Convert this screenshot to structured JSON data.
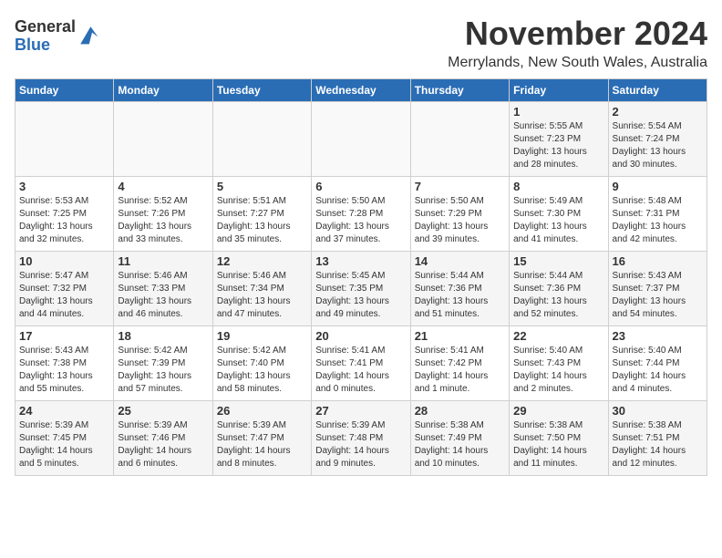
{
  "logo": {
    "general": "General",
    "blue": "Blue"
  },
  "header": {
    "month_title": "November 2024",
    "location": "Merrylands, New South Wales, Australia"
  },
  "weekdays": [
    "Sunday",
    "Monday",
    "Tuesday",
    "Wednesday",
    "Thursday",
    "Friday",
    "Saturday"
  ],
  "weeks": [
    [
      {
        "day": "",
        "info": ""
      },
      {
        "day": "",
        "info": ""
      },
      {
        "day": "",
        "info": ""
      },
      {
        "day": "",
        "info": ""
      },
      {
        "day": "",
        "info": ""
      },
      {
        "day": "1",
        "info": "Sunrise: 5:55 AM\nSunset: 7:23 PM\nDaylight: 13 hours\nand 28 minutes."
      },
      {
        "day": "2",
        "info": "Sunrise: 5:54 AM\nSunset: 7:24 PM\nDaylight: 13 hours\nand 30 minutes."
      }
    ],
    [
      {
        "day": "3",
        "info": "Sunrise: 5:53 AM\nSunset: 7:25 PM\nDaylight: 13 hours\nand 32 minutes."
      },
      {
        "day": "4",
        "info": "Sunrise: 5:52 AM\nSunset: 7:26 PM\nDaylight: 13 hours\nand 33 minutes."
      },
      {
        "day": "5",
        "info": "Sunrise: 5:51 AM\nSunset: 7:27 PM\nDaylight: 13 hours\nand 35 minutes."
      },
      {
        "day": "6",
        "info": "Sunrise: 5:50 AM\nSunset: 7:28 PM\nDaylight: 13 hours\nand 37 minutes."
      },
      {
        "day": "7",
        "info": "Sunrise: 5:50 AM\nSunset: 7:29 PM\nDaylight: 13 hours\nand 39 minutes."
      },
      {
        "day": "8",
        "info": "Sunrise: 5:49 AM\nSunset: 7:30 PM\nDaylight: 13 hours\nand 41 minutes."
      },
      {
        "day": "9",
        "info": "Sunrise: 5:48 AM\nSunset: 7:31 PM\nDaylight: 13 hours\nand 42 minutes."
      }
    ],
    [
      {
        "day": "10",
        "info": "Sunrise: 5:47 AM\nSunset: 7:32 PM\nDaylight: 13 hours\nand 44 minutes."
      },
      {
        "day": "11",
        "info": "Sunrise: 5:46 AM\nSunset: 7:33 PM\nDaylight: 13 hours\nand 46 minutes."
      },
      {
        "day": "12",
        "info": "Sunrise: 5:46 AM\nSunset: 7:34 PM\nDaylight: 13 hours\nand 47 minutes."
      },
      {
        "day": "13",
        "info": "Sunrise: 5:45 AM\nSunset: 7:35 PM\nDaylight: 13 hours\nand 49 minutes."
      },
      {
        "day": "14",
        "info": "Sunrise: 5:44 AM\nSunset: 7:36 PM\nDaylight: 13 hours\nand 51 minutes."
      },
      {
        "day": "15",
        "info": "Sunrise: 5:44 AM\nSunset: 7:36 PM\nDaylight: 13 hours\nand 52 minutes."
      },
      {
        "day": "16",
        "info": "Sunrise: 5:43 AM\nSunset: 7:37 PM\nDaylight: 13 hours\nand 54 minutes."
      }
    ],
    [
      {
        "day": "17",
        "info": "Sunrise: 5:43 AM\nSunset: 7:38 PM\nDaylight: 13 hours\nand 55 minutes."
      },
      {
        "day": "18",
        "info": "Sunrise: 5:42 AM\nSunset: 7:39 PM\nDaylight: 13 hours\nand 57 minutes."
      },
      {
        "day": "19",
        "info": "Sunrise: 5:42 AM\nSunset: 7:40 PM\nDaylight: 13 hours\nand 58 minutes."
      },
      {
        "day": "20",
        "info": "Sunrise: 5:41 AM\nSunset: 7:41 PM\nDaylight: 14 hours\nand 0 minutes."
      },
      {
        "day": "21",
        "info": "Sunrise: 5:41 AM\nSunset: 7:42 PM\nDaylight: 14 hours\nand 1 minute."
      },
      {
        "day": "22",
        "info": "Sunrise: 5:40 AM\nSunset: 7:43 PM\nDaylight: 14 hours\nand 2 minutes."
      },
      {
        "day": "23",
        "info": "Sunrise: 5:40 AM\nSunset: 7:44 PM\nDaylight: 14 hours\nand 4 minutes."
      }
    ],
    [
      {
        "day": "24",
        "info": "Sunrise: 5:39 AM\nSunset: 7:45 PM\nDaylight: 14 hours\nand 5 minutes."
      },
      {
        "day": "25",
        "info": "Sunrise: 5:39 AM\nSunset: 7:46 PM\nDaylight: 14 hours\nand 6 minutes."
      },
      {
        "day": "26",
        "info": "Sunrise: 5:39 AM\nSunset: 7:47 PM\nDaylight: 14 hours\nand 8 minutes."
      },
      {
        "day": "27",
        "info": "Sunrise: 5:39 AM\nSunset: 7:48 PM\nDaylight: 14 hours\nand 9 minutes."
      },
      {
        "day": "28",
        "info": "Sunrise: 5:38 AM\nSunset: 7:49 PM\nDaylight: 14 hours\nand 10 minutes."
      },
      {
        "day": "29",
        "info": "Sunrise: 5:38 AM\nSunset: 7:50 PM\nDaylight: 14 hours\nand 11 minutes."
      },
      {
        "day": "30",
        "info": "Sunrise: 5:38 AM\nSunset: 7:51 PM\nDaylight: 14 hours\nand 12 minutes."
      }
    ]
  ]
}
